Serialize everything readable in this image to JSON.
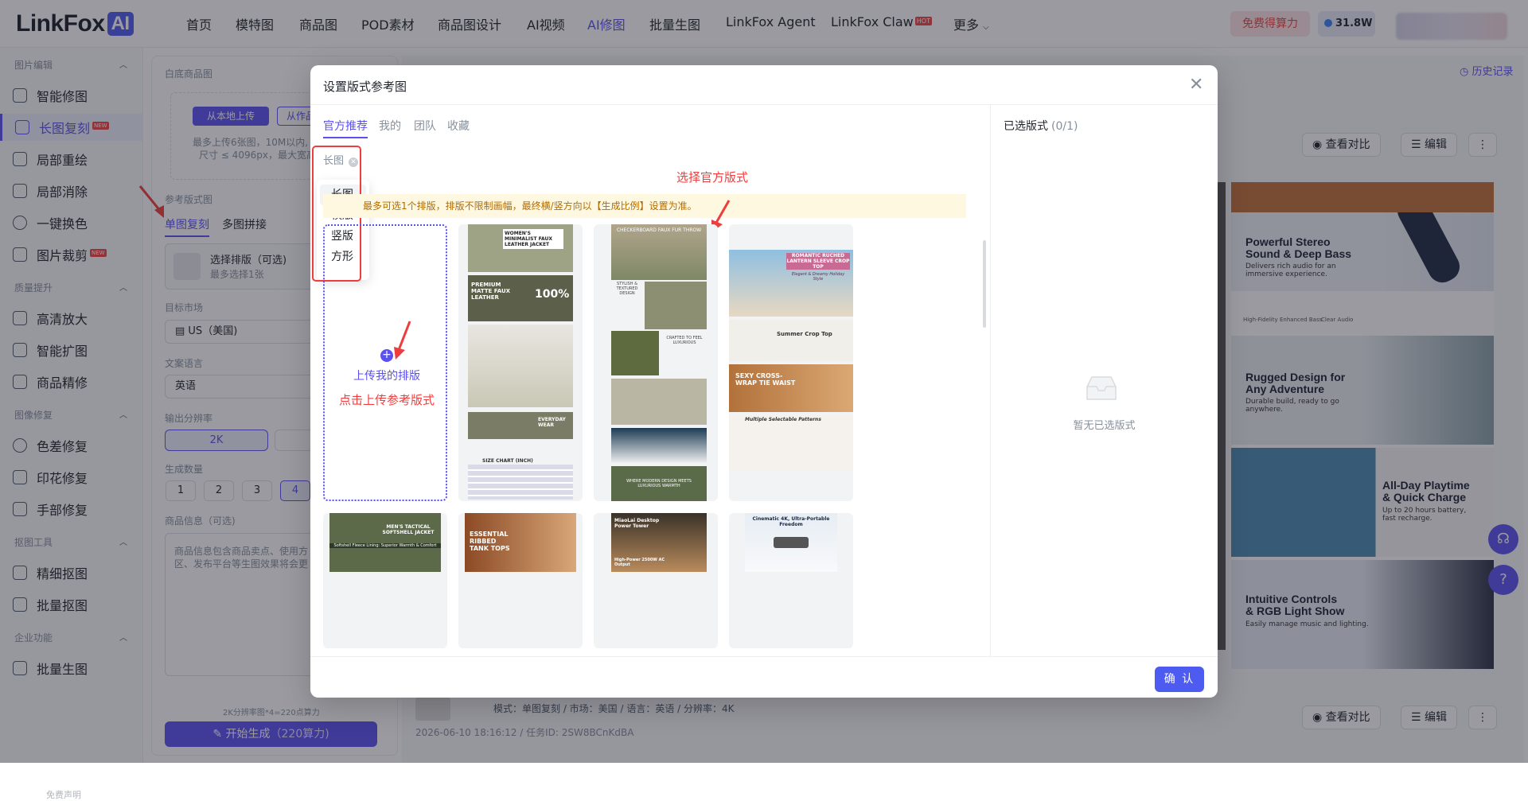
{
  "nav": {
    "logo_text": "LinkFox",
    "logo_badge": "AI",
    "items": [
      "首页",
      "模特图",
      "商品图",
      "POD素材",
      "商品图设计",
      "AI视频",
      "AI修图",
      "批量生图",
      "LinkFox Agent",
      "LinkFox Claw",
      "更多"
    ],
    "claw_badge": "HOT",
    "free_button": "免费得算力",
    "credits": "31.8W"
  },
  "sidebar": {
    "groups": {
      "g1": "图片编辑",
      "g2": "质量提升",
      "g3": "图像修复",
      "g4": "抠图工具",
      "g5": "企业功能"
    },
    "items": [
      "智能修图",
      "长图复刻",
      "局部重绘",
      "局部消除",
      "一键换色",
      "图片裁剪",
      "高清放大",
      "智能扩图",
      "商品精修",
      "色差修复",
      "印花修复",
      "手部修复",
      "精细抠图",
      "批量抠图",
      "批量生图"
    ],
    "new_badge": "NEW",
    "footer": "免费声明"
  },
  "form": {
    "white_bg_label": "白底商品图",
    "upload_local": "从本地上传",
    "upload_work": "从作品",
    "upload_hint_1": "最多上传6张图，10M以内,",
    "upload_hint_2": "尺寸 ≤ 4096px，最大宽高",
    "ref_label": "参考版式图",
    "tab_single": "单图复刻",
    "tab_multi": "多图拼接",
    "select_layout": "选择排版（可选)",
    "select_hint": "最多选择1张",
    "market_label": "目标市场",
    "market_value": "US（美国)",
    "lang_label": "文案语言",
    "lang_value": "英语",
    "res_label": "输出分辨率",
    "res_value": "2K",
    "count_label": "生成数量",
    "counts": [
      "1",
      "2",
      "3",
      "4"
    ],
    "info_label": "商品信息（可选)",
    "info_placeholder_1": "商品信息包含商品卖点、使用方",
    "info_placeholder_2": "区、发布平台等生图效果将会更",
    "cost_hint": "2K分辨率图*4=220点算力",
    "start_button": "开始生成",
    "start_cost": "（220算力)"
  },
  "main": {
    "history": "历史记录",
    "compare": "查看对比",
    "edit": "编辑",
    "more": "⋮",
    "meta_line": "模式：单图复刻  /  市场：美国  /  语言：英语  /  分辨率：4K",
    "meta_sub": "2026-06-10 18:16:12 / 任务ID: 2SW8BCnKdBA",
    "preview_cards": [
      {
        "title": "Powerful Stereo\nSound & Deep Bass",
        "sub": "Delivers rich audio for an\nimmersive experience."
      },
      {
        "title": "Rugged Design for\nAny Adventure",
        "sub": "Durable build, ready to go\nanywhere."
      },
      {
        "title": "All-Day Playtime\n& Quick Charge",
        "sub": "Up to 20 hours battery,\nfast recharge."
      },
      {
        "title": "Intuitive Controls\n& RGB Light Show",
        "sub": "Easily manage music and lighting."
      }
    ],
    "preview_icons": [
      "High-Fidelity",
      "Enhanced Bass",
      "Clear Audio"
    ]
  },
  "modal": {
    "title": "设置版式参考图",
    "tabs": [
      "官方推荐",
      "我的",
      "团队",
      "收藏"
    ],
    "filter_chip": "长图",
    "dropdown": [
      "长图",
      "横版",
      "竖版",
      "方形"
    ],
    "notice": "最多可选1个排版，排版不限制画幅，最终横/竖方向以【生成比例】设置为准。",
    "upload_label": "上传我的排版",
    "annotation_upload": "点击上传参考版式",
    "annotation_official": "选择官方版式",
    "selected_title": "已选版式",
    "selected_count": "(0/1)",
    "empty_text": "暂无已选版式",
    "confirm": "确 认",
    "cards": [
      {
        "head": "WOMEN'S MINIMALIST FAUX LEATHER JACKET",
        "mid": "PREMIUM MATTE FAUX LEATHER",
        "big": "100%",
        "chart": "SIZE CHART (INCH)",
        "foot": "EVERYDAY WEAR"
      },
      {
        "head": "CHECKERBOARD FAUX FUR THROW",
        "mid": "STYLISH & TEXTURED DESIGN",
        "mid2": "CRAFTED TO FEEL LUXURIOUS",
        "foot": "WHERE MODERN DESIGN MEETS LUXURIOUS WARMTH"
      },
      {
        "head": "ROMANTIC RUCHED LANTERN SLEEVE CROP TOP",
        "sub": "Elegant & Dreamy Holiday Style",
        "mid": "Summer Crop Top",
        "banner": "SEXY CROSS-WRAP TIE WAIST",
        "foot": "Multiple Selectable Patterns"
      }
    ],
    "cards2": [
      {
        "head": "MEN'S TACTICAL SOFTSHELL JACKET",
        "sub": "Softshell Fleece Lining: Superior Warmth & Comfort"
      },
      {
        "head": "ESSENTIAL RIBBED TANK TOPS"
      },
      {
        "head": "MiaoLai Desktop Power Tower",
        "sub": "High-Power 2500W AC Output"
      },
      {
        "head": "Cinematic 4K, Ultra-Portable Freedom"
      }
    ]
  },
  "colors": {
    "accent": "#5b50f0",
    "annotation": "#ef3d3d",
    "notice_bg": "#fff8e1"
  }
}
